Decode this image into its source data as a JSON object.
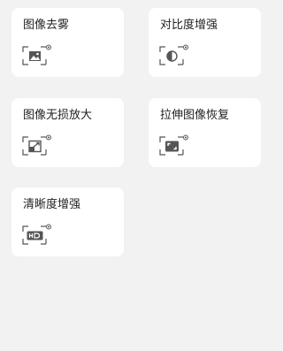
{
  "tools": [
    {
      "label": "图像去雾",
      "icon": "image-dehaze-icon"
    },
    {
      "label": "对比度增强",
      "icon": "contrast-icon"
    },
    {
      "label": "图像无损放大",
      "icon": "enlarge-icon"
    },
    {
      "label": "拉伸图像恢复",
      "icon": "stretch-restore-icon"
    },
    {
      "label": "清晰度增强",
      "icon": "hd-icon"
    }
  ],
  "colors": {
    "background": "#f2f2f2",
    "card": "#ffffff",
    "text": "#222222",
    "icon": "#555555"
  }
}
